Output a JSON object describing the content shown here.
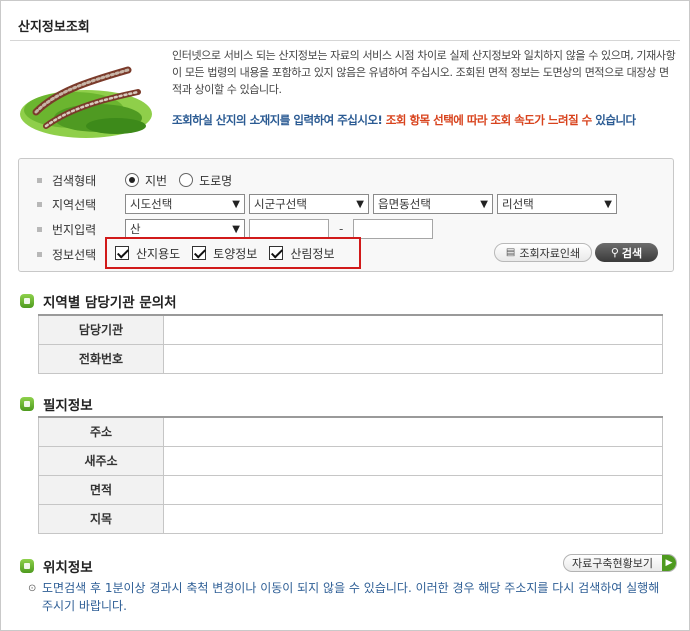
{
  "page": {
    "title": "산지정보조회"
  },
  "notice": {
    "text": "인터넷으로 서비스 되는 산지정보는 자료의 서비스 시점 차이로 실제 산지정보와 일치하지 않을 수 있으며, 기재사항이 모든 법령의 내용을 포함하고 있지 않음은 유념하여 주십시오. 조회된 면적 정보는 도면상의 면적으로 대장상 면적과 상이할 수 있습니다.",
    "cta_blue": "조회하실 산지의 소재지를 입력하여 주십시오!",
    "cta_red": "조회 항목 선택에 따라 조회 속도가 느려질 수",
    "cta_tail": "있습니다"
  },
  "search": {
    "search_type_label": "검색형태",
    "search_type_options": [
      {
        "label": "지번",
        "selected": true
      },
      {
        "label": "도로명",
        "selected": false
      }
    ],
    "region_label": "지역선택",
    "region_selects": [
      "시도선택",
      "시군구선택",
      "읍면동선택",
      "리선택"
    ],
    "lot_label": "번지입력",
    "lot_type": "산",
    "lot_main": "",
    "lot_dash": "-",
    "lot_sub": "",
    "info_label": "정보선택",
    "info_checks": [
      {
        "label": "산지용도",
        "checked": true
      },
      {
        "label": "토양정보",
        "checked": true
      },
      {
        "label": "산림정보",
        "checked": true
      }
    ],
    "print_button": "조회자료인쇄",
    "search_button": "검색"
  },
  "agency": {
    "title": "지역별 담당기관 문의처",
    "rows": [
      {
        "label": "담당기관",
        "value": ""
      },
      {
        "label": "전화번호",
        "value": ""
      }
    ]
  },
  "parcel": {
    "title": "필지정보",
    "rows": [
      {
        "label": "주소",
        "value": ""
      },
      {
        "label": "새주소",
        "value": ""
      },
      {
        "label": "면적",
        "value": ""
      },
      {
        "label": "지목",
        "value": ""
      }
    ]
  },
  "location": {
    "title": "위치정보",
    "status_button": "자료구축현황보기",
    "note": "도면검색 후 1분이상 경과시 축척 변경이나 이동이 되지 않을 수 있습니다. 이러한 경우 해당 주소지를 다시 검색하여 실행해 주시기 바랍니다."
  },
  "colors": {
    "accent_red": "#d8431d",
    "accent_blue": "#2b5b93",
    "section_green": "#4e9a1f",
    "highlight_border": "#d11a1a"
  }
}
